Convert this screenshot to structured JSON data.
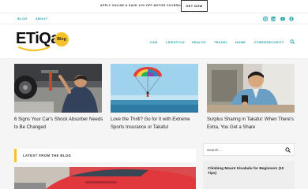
{
  "promo": {
    "text": "APPLY ONLINE & SAVE 10% OFF MOTOR COVERAGE",
    "button_label": "GET NOW"
  },
  "utility": {
    "links": [
      "BLOG",
      "ABOUT"
    ],
    "social_icons": [
      "instagram-icon",
      "linkedin-icon",
      "youtube-icon",
      "facebook-icon"
    ]
  },
  "brand": {
    "logo_text": "ETiQa",
    "badge_text": "Blog",
    "accent_color": "#f6c22a",
    "nav_color": "#1aa0a8"
  },
  "nav": {
    "items": [
      "CAR",
      "LIFESTYLE",
      "HEALTH",
      "TRAVEL",
      "HOME",
      "CYBERSECURITY"
    ]
  },
  "featured": [
    {
      "title": "6 Signs Your Car's Shock Absorber Needs to Be Changed"
    },
    {
      "title": "Love the Thrill? Go for It with Extreme Sports Insurance or Takaful"
    },
    {
      "title": "Surplus Sharing in Takaful: When There's Extra, You Get a Share"
    }
  ],
  "section": {
    "label": "LATEST FROM THE BLOG"
  },
  "sidebar": {
    "search_placeholder": "Search ...",
    "card_title": "Climbing Mount Kinabalu for Beginners (10 Tips)"
  }
}
